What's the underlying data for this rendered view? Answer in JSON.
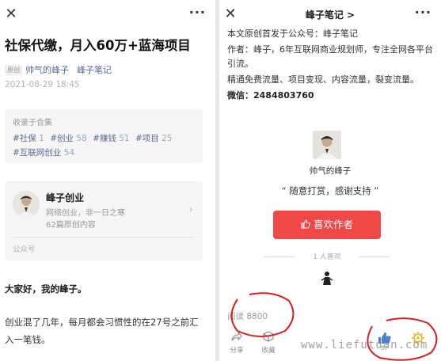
{
  "left": {
    "close_glyph": "✕",
    "more_glyph": "···",
    "article_title": "社保代缴，月入60万+蓝海项目",
    "original_tag": "原创",
    "author": "帅气的峰子",
    "account": "峰子笔记",
    "date": "2021-08-29 18:45",
    "collection": {
      "title": "收录于合集",
      "tags": [
        {
          "name": "#社保",
          "count": "1"
        },
        {
          "name": "#创业",
          "count": "58"
        },
        {
          "name": "#赚钱",
          "count": "51"
        },
        {
          "name": "#项目",
          "count": "25"
        },
        {
          "name": "#互联网创业",
          "count": "54"
        }
      ]
    },
    "account_card": {
      "name": "峰子创业",
      "desc": "网络创业，非一日之寒",
      "count": "62篇原创内容",
      "kind": "公众号",
      "chevron": "›"
    },
    "greeting": "大家好，我的峰子。",
    "paragraph": "创业混了几年，每月都会习惯性的在27号之前汇入一笔钱。"
  },
  "right": {
    "close_glyph": "✕",
    "more_glyph": "···",
    "title": "峰子笔记 >",
    "body": [
      "本文原创首发于公众号：峰子笔记",
      "作者：峰子，6年互联网商业规划师，专注全网各平台引流。",
      "精通免费流量、项目变现、内容流量，裂变流量。"
    ],
    "wechat": "微信：2484803760",
    "author_name": "帅气的峰子",
    "reward_quote": "“ 随意打赏，感谢支持 ”",
    "like_button": "喜欢作者",
    "liked_count": "1 人喜欢",
    "reads": "阅读 8800",
    "share_label": "分享",
    "collect_label": "收藏",
    "like_count": "37",
    "colors": {
      "accent_red": "#f04747",
      "link_blue": "#576b95"
    }
  },
  "watermark": "www.liefutuan.com"
}
